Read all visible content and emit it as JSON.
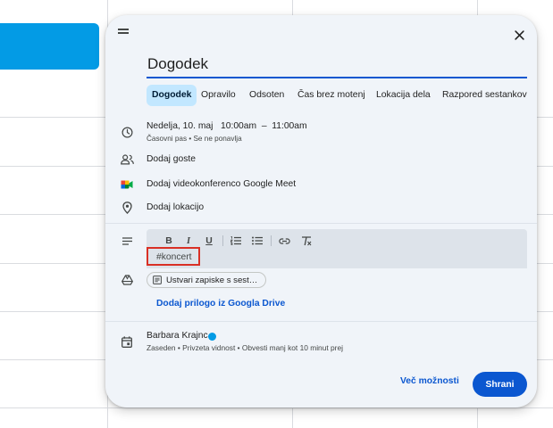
{
  "dialog": {
    "title_value": "Dogodek",
    "tabs": [
      {
        "label": "Dogodek",
        "active": true
      },
      {
        "label": "Opravilo"
      },
      {
        "label": "Odsoten"
      },
      {
        "label": "Čas brez motenj"
      },
      {
        "label": "Lokacija dela"
      },
      {
        "label": "Razpored sestankov"
      }
    ],
    "datetime": {
      "date": "Nedelja, 10. maj",
      "start": "10:00am",
      "separator": "–",
      "end": "11:00am",
      "sub": "Časovni pas • Se ne ponavlja"
    },
    "add_guests": "Dodaj goste",
    "add_meet": "Dodaj videokonferenco Google Meet",
    "add_location": "Dodaj lokacijo",
    "description": "#koncert",
    "notes_chip": "Ustvari zapiske s sest…",
    "drive_link": "Dodaj prilogo iz Googla Drive",
    "owner": {
      "name": "Barbara Krajnc",
      "sub": "Zaseden • Privzeta vidnost • Obvesti manj kot 10 minut prej",
      "color": "#039be5"
    },
    "more_options": "Več možnosti",
    "save": "Shrani"
  },
  "colors": {
    "accent": "#0b57d0",
    "active_tab_bg": "#c2e7ff",
    "highlight": "#d93025",
    "event_chip": "#039be5"
  }
}
